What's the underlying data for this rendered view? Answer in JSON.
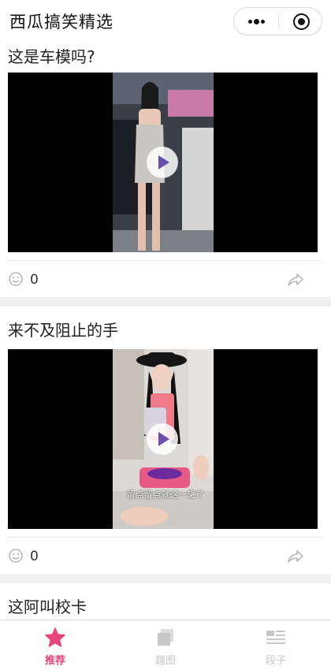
{
  "app": {
    "title": "西瓜搞笑精选"
  },
  "capsule": {
    "more_icon": "more-dots-icon",
    "close_icon": "target-close-icon"
  },
  "feed": [
    {
      "title": "这是车模吗?",
      "video_caption": "",
      "like_count": "0"
    },
    {
      "title": "来不及阻止的手",
      "video_caption": "留点留点就这一罐了",
      "like_count": "0"
    },
    {
      "title": "这阿叫校卡"
    }
  ],
  "tabs": [
    {
      "label": "推荐",
      "icon": "star-icon",
      "active": true
    },
    {
      "label": "趣图",
      "icon": "images-icon",
      "active": false
    },
    {
      "label": "段子",
      "icon": "text-list-icon",
      "active": false
    }
  ],
  "colors": {
    "accent": "#e6457a",
    "inactive": "#c8c8c8",
    "divider": "#eef0f2"
  }
}
